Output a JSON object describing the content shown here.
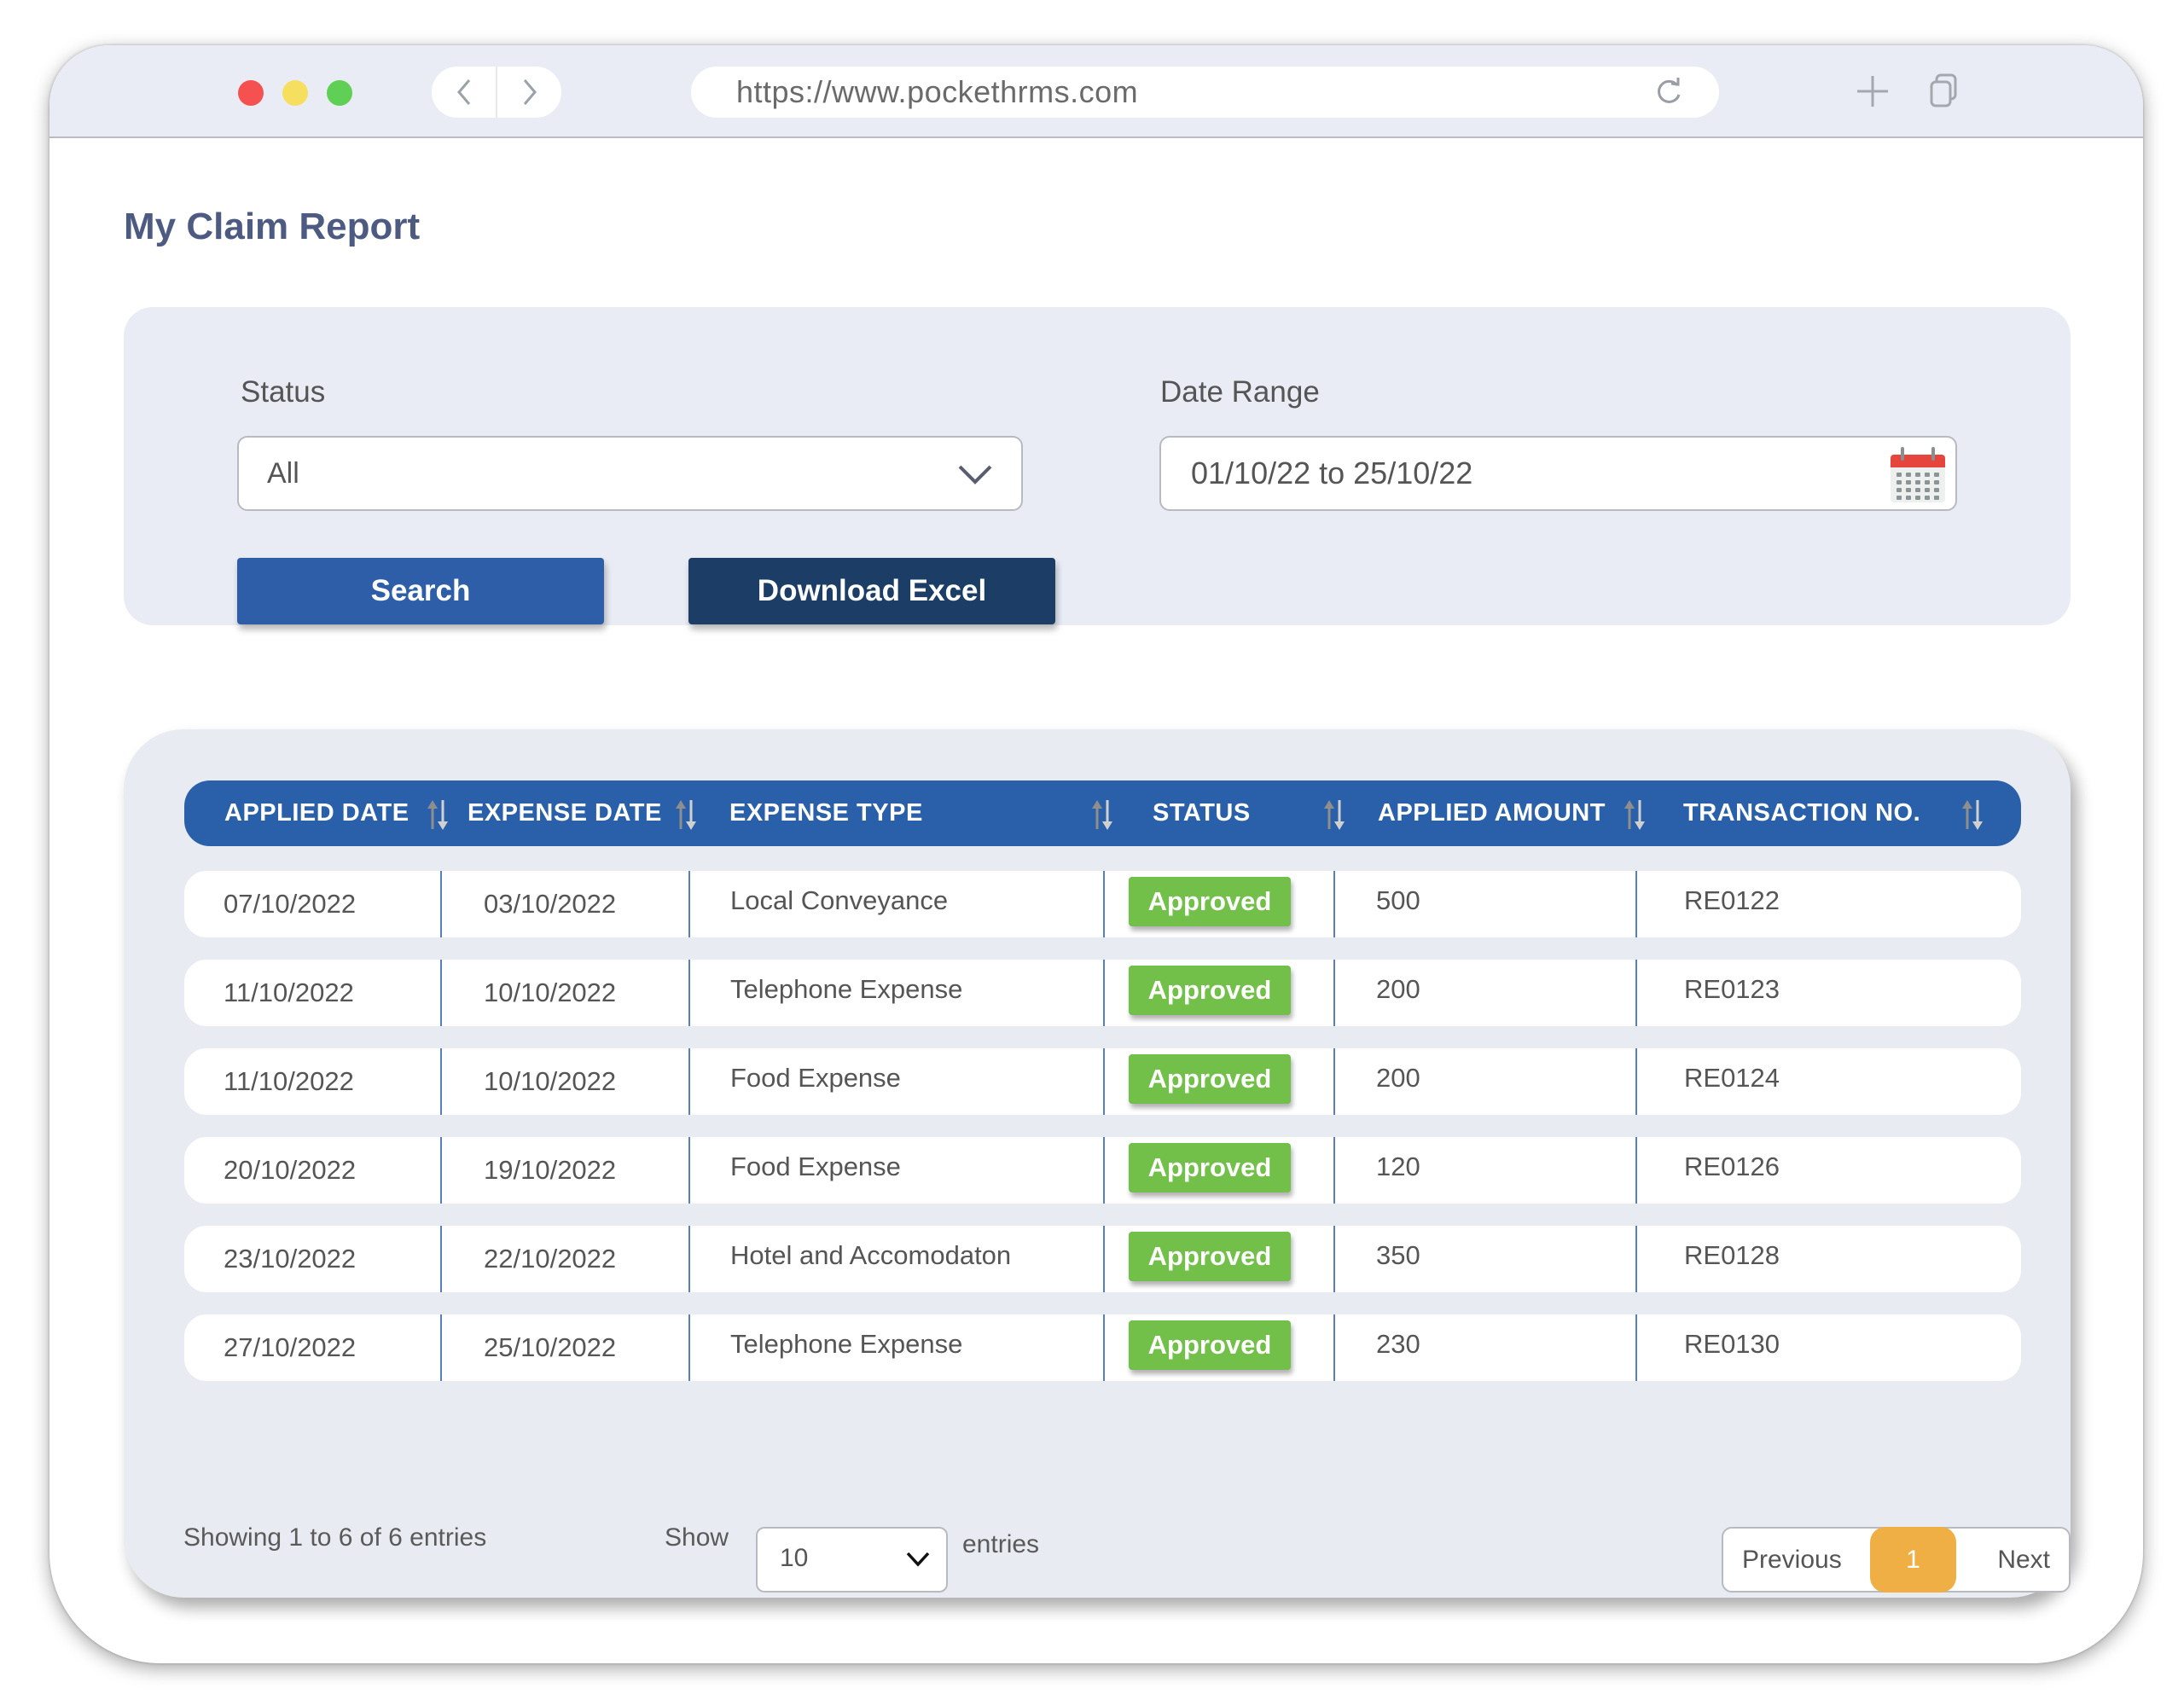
{
  "browser": {
    "url": "https://www.pockethrms.com",
    "icons": {
      "close": "red-traffic-light",
      "minimize": "yellow-traffic-light",
      "maximize": "green-traffic-light",
      "back": "chevron-left-icon",
      "forward": "chevron-right-icon",
      "reload": "reload-icon",
      "new_tab": "plus-icon",
      "tabs": "copy-icon"
    }
  },
  "page": {
    "title": "My Claim Report"
  },
  "filters": {
    "status_label": "Status",
    "status_value": "All",
    "date_label": "Date Range",
    "date_value": "01/10/22 to 25/10/22",
    "search_label": "Search",
    "download_label": "Download Excel"
  },
  "table": {
    "columns": [
      "APPLIED DATE",
      "EXPENSE DATE",
      "EXPENSE TYPE",
      "STATUS",
      "APPLIED AMOUNT",
      "TRANSACTION NO."
    ],
    "rows": [
      {
        "applied_date": "07/10/2022",
        "expense_date": "03/10/2022",
        "expense_type": "Local Conveyance",
        "status": "Approved",
        "amount": "500",
        "transaction": "RE0122"
      },
      {
        "applied_date": "11/10/2022",
        "expense_date": "10/10/2022",
        "expense_type": "Telephone Expense",
        "status": "Approved",
        "amount": "200",
        "transaction": "RE0123"
      },
      {
        "applied_date": "11/10/2022",
        "expense_date": "10/10/2022",
        "expense_type": "Food Expense",
        "status": "Approved",
        "amount": "200",
        "transaction": "RE0124"
      },
      {
        "applied_date": "20/10/2022",
        "expense_date": "19/10/2022",
        "expense_type": "Food Expense",
        "status": "Approved",
        "amount": "120",
        "transaction": "RE0126"
      },
      {
        "applied_date": "23/10/2022",
        "expense_date": "22/10/2022",
        "expense_type": "Hotel and Accomodaton",
        "status": "Approved",
        "amount": "350",
        "transaction": "RE0128"
      },
      {
        "applied_date": "27/10/2022",
        "expense_date": "25/10/2022",
        "expense_type": "Telephone Expense",
        "status": "Approved",
        "amount": "230",
        "transaction": "RE0130"
      }
    ]
  },
  "footer": {
    "info": "Showing 1 to 6 of 6 entries",
    "show_label": "Show",
    "page_size": "10",
    "entries_label": "entries",
    "previous_label": "Previous",
    "current_page": "1",
    "next_label": "Next"
  },
  "colors": {
    "header_blue": "#2a60aa",
    "search_button": "#2e5ea8",
    "download_button": "#1b3d66",
    "approved_green": "#72bf4a",
    "active_page": "#efaf45",
    "title_color": "#4d5b82"
  }
}
